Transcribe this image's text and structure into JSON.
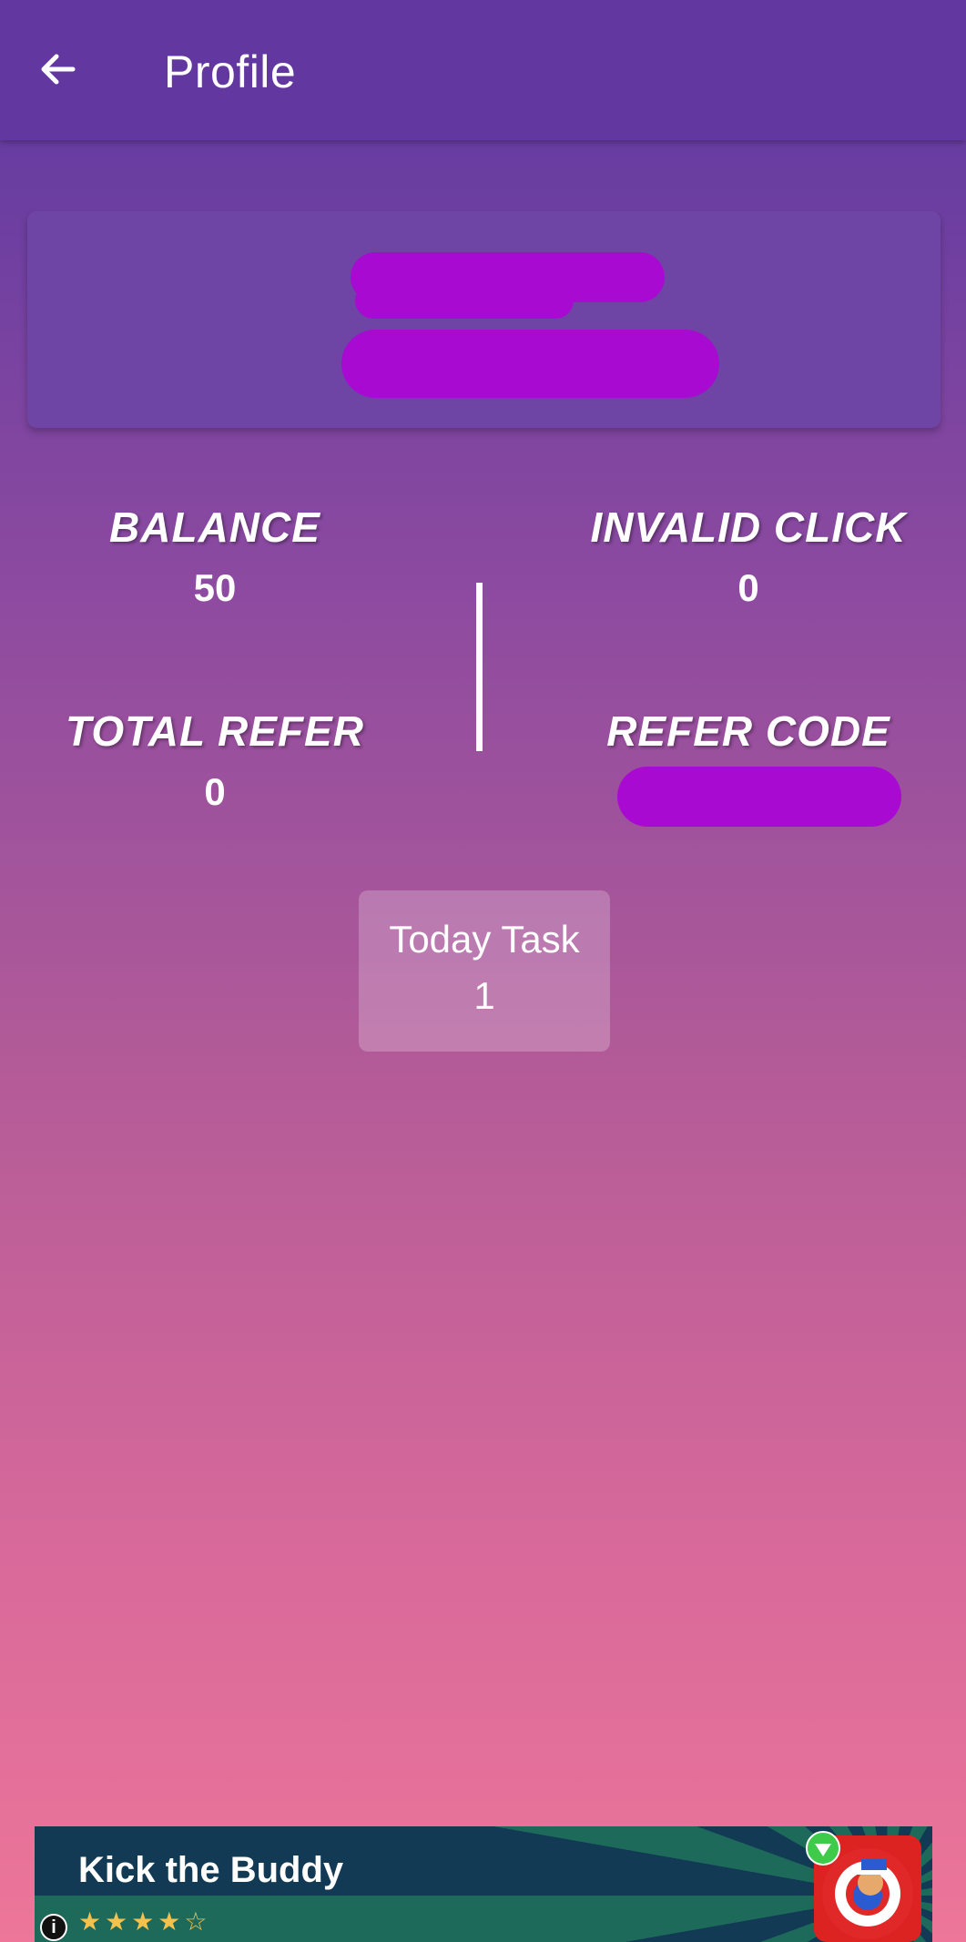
{
  "appbar": {
    "title": "Profile",
    "back_icon": "arrow-left-icon"
  },
  "profile_card": {
    "name": "",
    "subtitle": "",
    "redaction_color": "#a80ad2"
  },
  "stats": {
    "balance_label": "BALANCE",
    "balance_value": "50",
    "invalid_click_label": "INVALID CLICK",
    "invalid_click_value": "0",
    "total_refer_label": "TOTAL REFER",
    "total_refer_value": "0",
    "refer_code_label": "REFER CODE",
    "refer_code_value": ""
  },
  "today_task": {
    "label": "Today Task",
    "value": "1"
  },
  "ad": {
    "title": "Kick the Buddy",
    "rating": 4,
    "stars": "★★★★☆",
    "info_icon": "info-icon",
    "app_icon": "game-app-icon",
    "download_icon": "download-badge-icon"
  },
  "colors": {
    "appbar": "#6238a0",
    "gradient_top": "#5f3aa0",
    "gradient_bottom": "#ed7699",
    "redaction": "#a80ad2"
  }
}
